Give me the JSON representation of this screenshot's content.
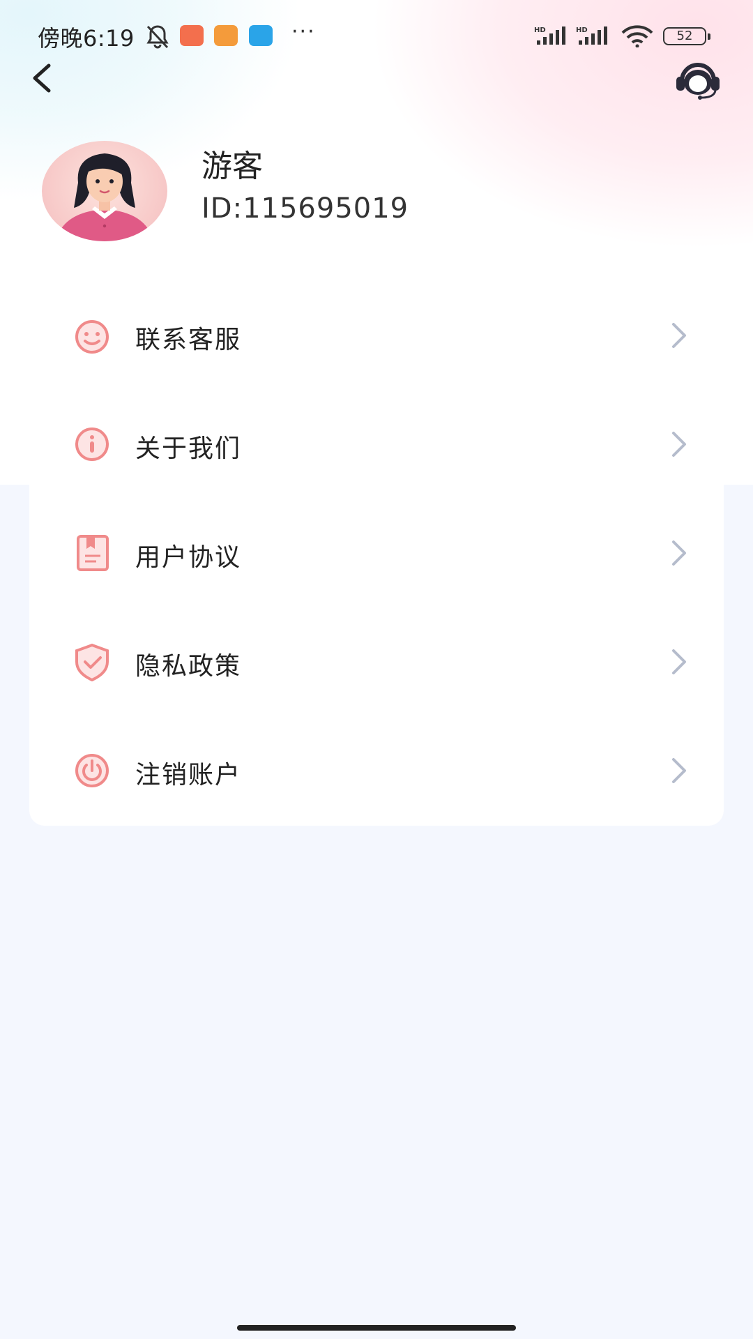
{
  "status_bar": {
    "time": "傍晚6:19",
    "more": "···",
    "battery": "52",
    "signal_label": "HD"
  },
  "nav": {
    "back_icon": "chevron-left-icon",
    "support_icon": "headset-icon"
  },
  "profile": {
    "name": "游客",
    "id_text": "ID:115695019"
  },
  "menu": {
    "items": [
      {
        "label": "联系客服",
        "icon": "smile-icon"
      },
      {
        "label": "关于我们",
        "icon": "info-icon"
      },
      {
        "label": "用户协议",
        "icon": "document-icon"
      },
      {
        "label": "隐私政策",
        "icon": "shield-check-icon"
      },
      {
        "label": "注销账户",
        "icon": "power-icon"
      }
    ]
  },
  "colors": {
    "accent_pink": "#f08a8a",
    "background": "#f4f7fe",
    "chevron": "#b5bccc"
  }
}
